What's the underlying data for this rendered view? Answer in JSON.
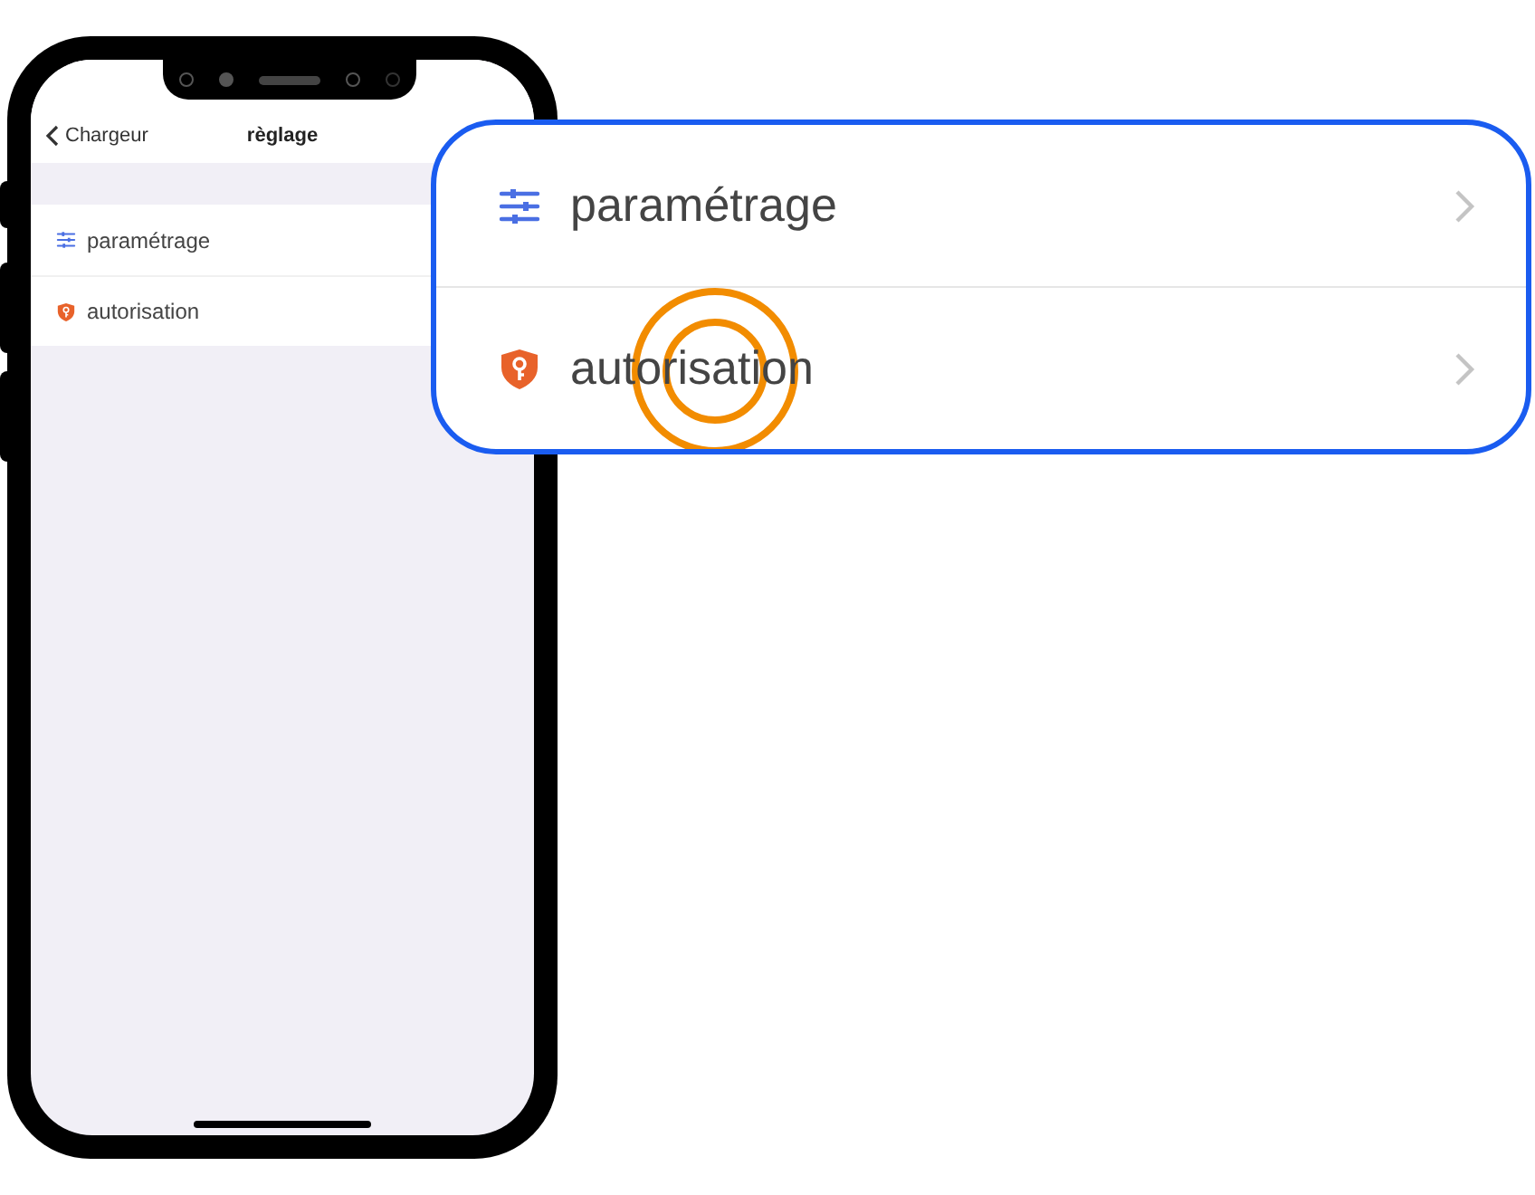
{
  "screen": {
    "nav": {
      "back": "Chargeur",
      "title": "règlage"
    },
    "items": [
      {
        "kind": "settings",
        "label": "paramétrage"
      },
      {
        "kind": "permission",
        "label": "autorisation"
      }
    ]
  },
  "callout": {
    "items": [
      {
        "kind": "settings",
        "label": "paramétrage",
        "tapped": false
      },
      {
        "kind": "permission",
        "label": "autorisation",
        "tapped": true
      }
    ]
  }
}
